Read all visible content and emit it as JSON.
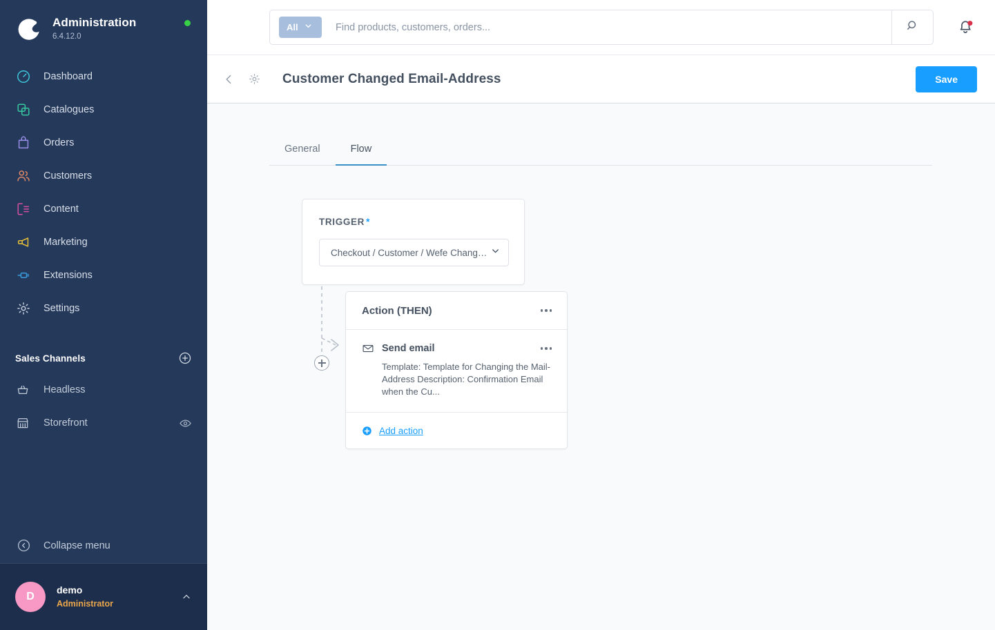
{
  "sidebar": {
    "brand": {
      "title": "Administration",
      "version": "6.4.12.0",
      "status_color": "#37d046"
    },
    "items": [
      {
        "label": "Dashboard",
        "icon": "gauge-icon",
        "color": "#3ec8db"
      },
      {
        "label": "Catalogues",
        "icon": "copy-icon",
        "color": "#37caa0"
      },
      {
        "label": "Orders",
        "icon": "bag-icon",
        "color": "#9a8fe8"
      },
      {
        "label": "Customers",
        "icon": "users-icon",
        "color": "#e08a6a"
      },
      {
        "label": "Content",
        "icon": "layout-icon",
        "color": "#d94fa0"
      },
      {
        "label": "Marketing",
        "icon": "megaphone-icon",
        "color": "#e9c238"
      },
      {
        "label": "Extensions",
        "icon": "plug-icon",
        "color": "#3a9ee0"
      },
      {
        "label": "Settings",
        "icon": "gear-icon",
        "color": "#c9d2de"
      }
    ],
    "sales_channels": {
      "title": "Sales Channels",
      "add_icon": "plus-circle-icon",
      "items": [
        {
          "label": "Headless",
          "icon": "basket-icon",
          "has_eye": false
        },
        {
          "label": "Storefront",
          "icon": "shop-icon",
          "has_eye": true
        }
      ]
    },
    "collapse": {
      "label": "Collapse menu",
      "icon": "collapse-icon"
    },
    "user": {
      "initial": "D",
      "name": "demo",
      "role": "Administrator",
      "avatar_color": "#f799c4",
      "caret_icon": "chevron-up-icon"
    }
  },
  "topbar": {
    "search": {
      "scope_label": "All",
      "scope_caret": "chevron-down-icon",
      "placeholder": "Find products, customers, orders...",
      "value": "",
      "button_icon": "search-icon"
    },
    "notifications": {
      "icon": "bell-icon",
      "has_badge": true,
      "badge_color": "#d8314a"
    }
  },
  "page_header": {
    "back_icon": "chevron-left-icon",
    "settings_icon": "gear-icon",
    "title": "Customer Changed Email-Address",
    "save_label": "Save",
    "save_color": "#189eff"
  },
  "tabs": [
    {
      "label": "General",
      "active": false
    },
    {
      "label": "Flow",
      "active": true
    }
  ],
  "flow": {
    "trigger": {
      "label": "TRIGGER",
      "required_marker": "*",
      "selected_value": "Checkout / Customer / Wefe Changed ...",
      "caret_icon": "chevron-down-icon"
    },
    "action_card": {
      "title": "Action (THEN)",
      "menu_icon": "ellipsis-icon",
      "actions": [
        {
          "name": "Send email",
          "icon": "mail-icon",
          "menu_icon": "ellipsis-icon",
          "details": "Template: Template for Changing the Mail-Address\nDescription: Confirmation Email when the Cu..."
        }
      ],
      "add_action_label": "Add action",
      "add_action_icon": "plus-circle-filled-icon"
    },
    "connector": {
      "add_node_icon": "plus-circle-icon"
    }
  }
}
